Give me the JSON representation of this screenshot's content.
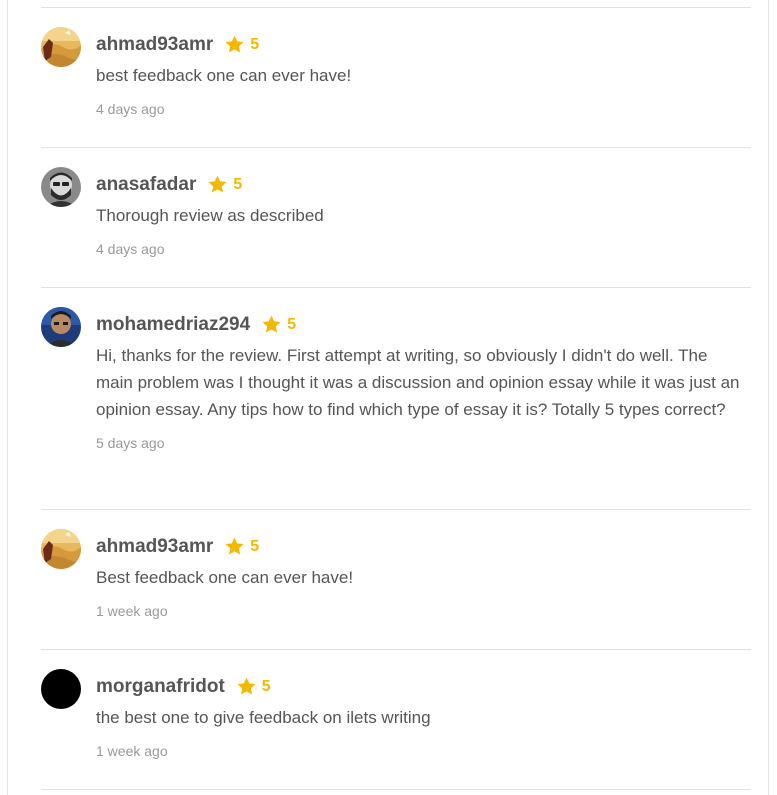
{
  "reviews": [
    {
      "username": "ahmad93amr",
      "rating": "5",
      "comment": "best feedback one can ever have!",
      "time": "4 days ago",
      "avatar": "desert-landscape-avatar"
    },
    {
      "username": "anasafadar",
      "rating": "5",
      "comment": "Thorough review as described",
      "time": "4 days ago",
      "avatar": "bearded-man-avatar"
    },
    {
      "username": "mohamedriaz294",
      "rating": "5",
      "comment": "Hi, thanks for the review. First attempt at writing, so obviously I didn't do well. The main problem was I thought it was a discussion and opinion essay while it was just an opinion essay. Any tips how to find which type of essay it is? Totally 5 types correct?",
      "time": "5 days ago",
      "avatar": "man-portrait-avatar"
    },
    {
      "username": "ahmad93amr",
      "rating": "5",
      "comment": "Best feedback one can ever have!",
      "time": "1 week ago",
      "avatar": "desert-landscape-avatar"
    },
    {
      "username": "morganafridot",
      "rating": "5",
      "comment": "the best one to give feedback on ilets writing",
      "time": "1 week ago",
      "avatar": "black-circle-avatar"
    }
  ],
  "colors": {
    "star": "#f5b800",
    "text": "#555555",
    "muted": "#999999",
    "divider": "#e1e1e1"
  }
}
